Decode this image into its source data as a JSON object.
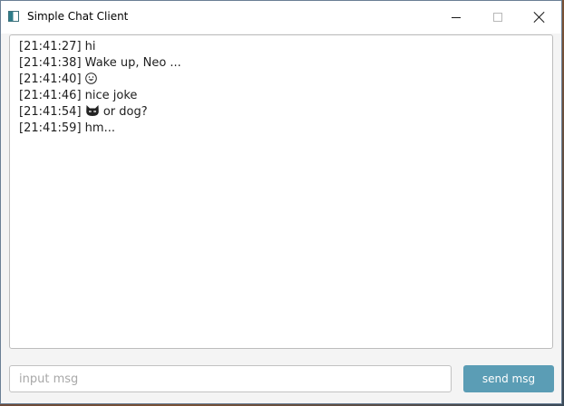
{
  "window": {
    "title": "Simple Chat Client",
    "icons": {
      "app": "app-window-icon",
      "minimize": "minimize-icon",
      "maximize": "maximize-icon",
      "close": "close-icon"
    }
  },
  "chat": {
    "messages": [
      {
        "time": "[21:41:27]",
        "text": "hi"
      },
      {
        "time": "[21:41:38]",
        "text": "Wake up, Neo ..."
      },
      {
        "time": "[21:41:40]",
        "emoji": "grinning-face-emoji",
        "text": ""
      },
      {
        "time": "[21:41:46]",
        "text": "nice joke"
      },
      {
        "time": "[21:41:54]",
        "emoji": "cat-face-emoji",
        "text": "or dog?"
      },
      {
        "time": "[21:41:59]",
        "text": "hm..."
      }
    ]
  },
  "composer": {
    "placeholder": "input msg",
    "value": "",
    "send_label": "send msg"
  },
  "colors": {
    "send_button": "#5b9db5",
    "chat_background": "#ffffff",
    "window_background": "#f4f4f4"
  }
}
